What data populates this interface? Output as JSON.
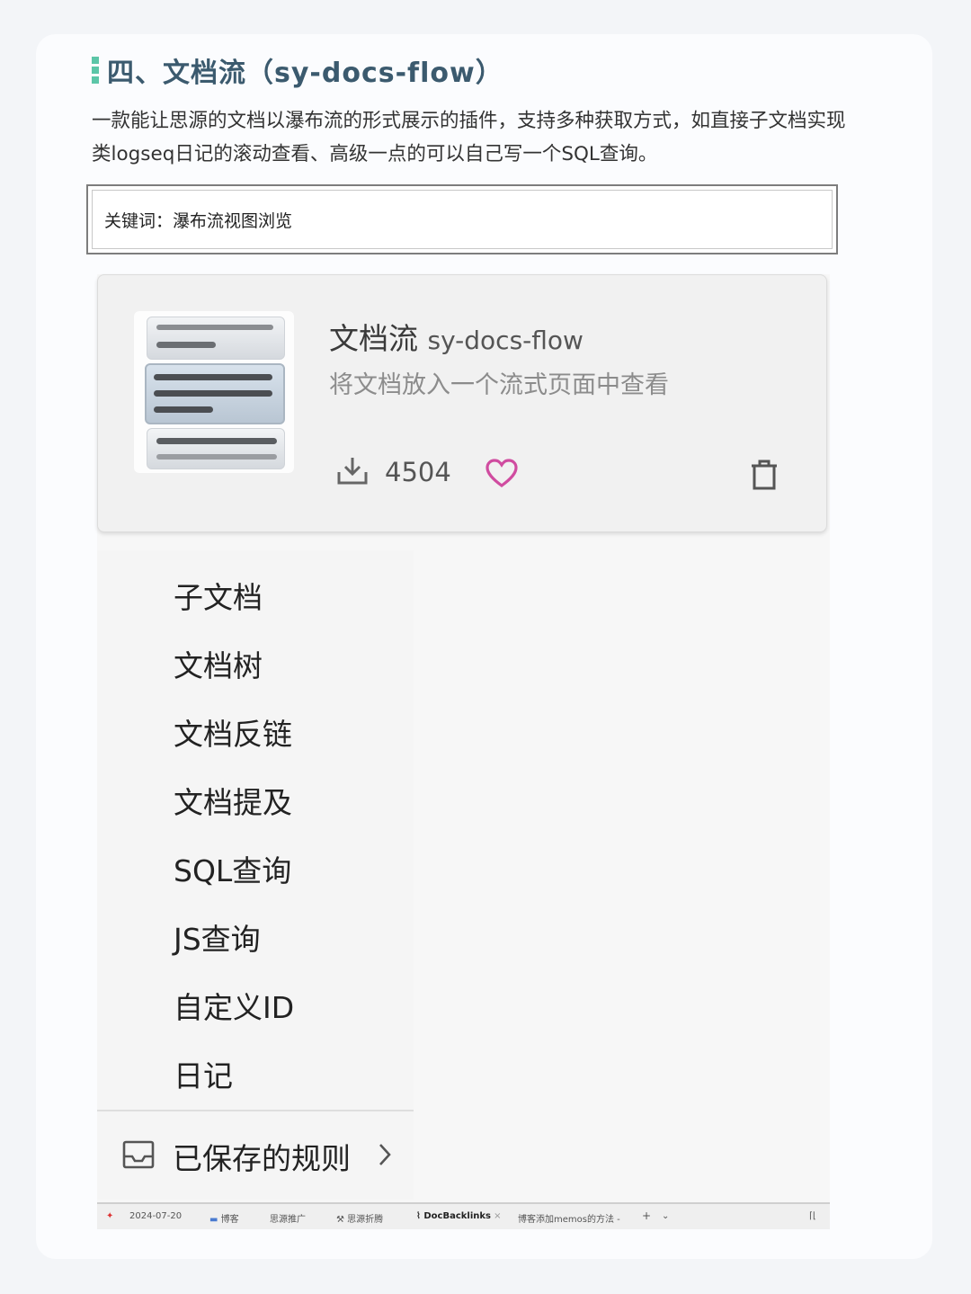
{
  "article": {
    "heading": "四、文档流（sy-docs-flow）",
    "description": "一款能让思源的文档以瀑布流的形式展示的插件，支持多种获取方式，如直接子文档实现类logseq日记的滚动查看、高级一点的可以自己写一个SQL查询。",
    "keywords": "关键词：瀑布流视图浏览"
  },
  "plugin": {
    "title_cn": "文档流",
    "title_en": "sy-docs-flow",
    "subtitle": "将文档放入一个流式页面中查看",
    "downloads": "4504",
    "icons": {
      "download": "download-icon",
      "favorite": "heart-icon",
      "delete": "trash-icon"
    },
    "accent_color": "#d04ca0"
  },
  "menu": {
    "items": [
      "子文档",
      "文档树",
      "文档反链",
      "文档提及",
      "SQL查询",
      "JS查询",
      "自定义ID",
      "日记"
    ],
    "saved_rules_label": "已保存的规则"
  },
  "taskbar": {
    "tabs": [
      "2024-07-20",
      "博客",
      "思源推广",
      "思源折腾",
      "DocBacklinks",
      "博客添加memos的方法 -"
    ],
    "active_tab": "DocBacklinks",
    "add": "+"
  }
}
